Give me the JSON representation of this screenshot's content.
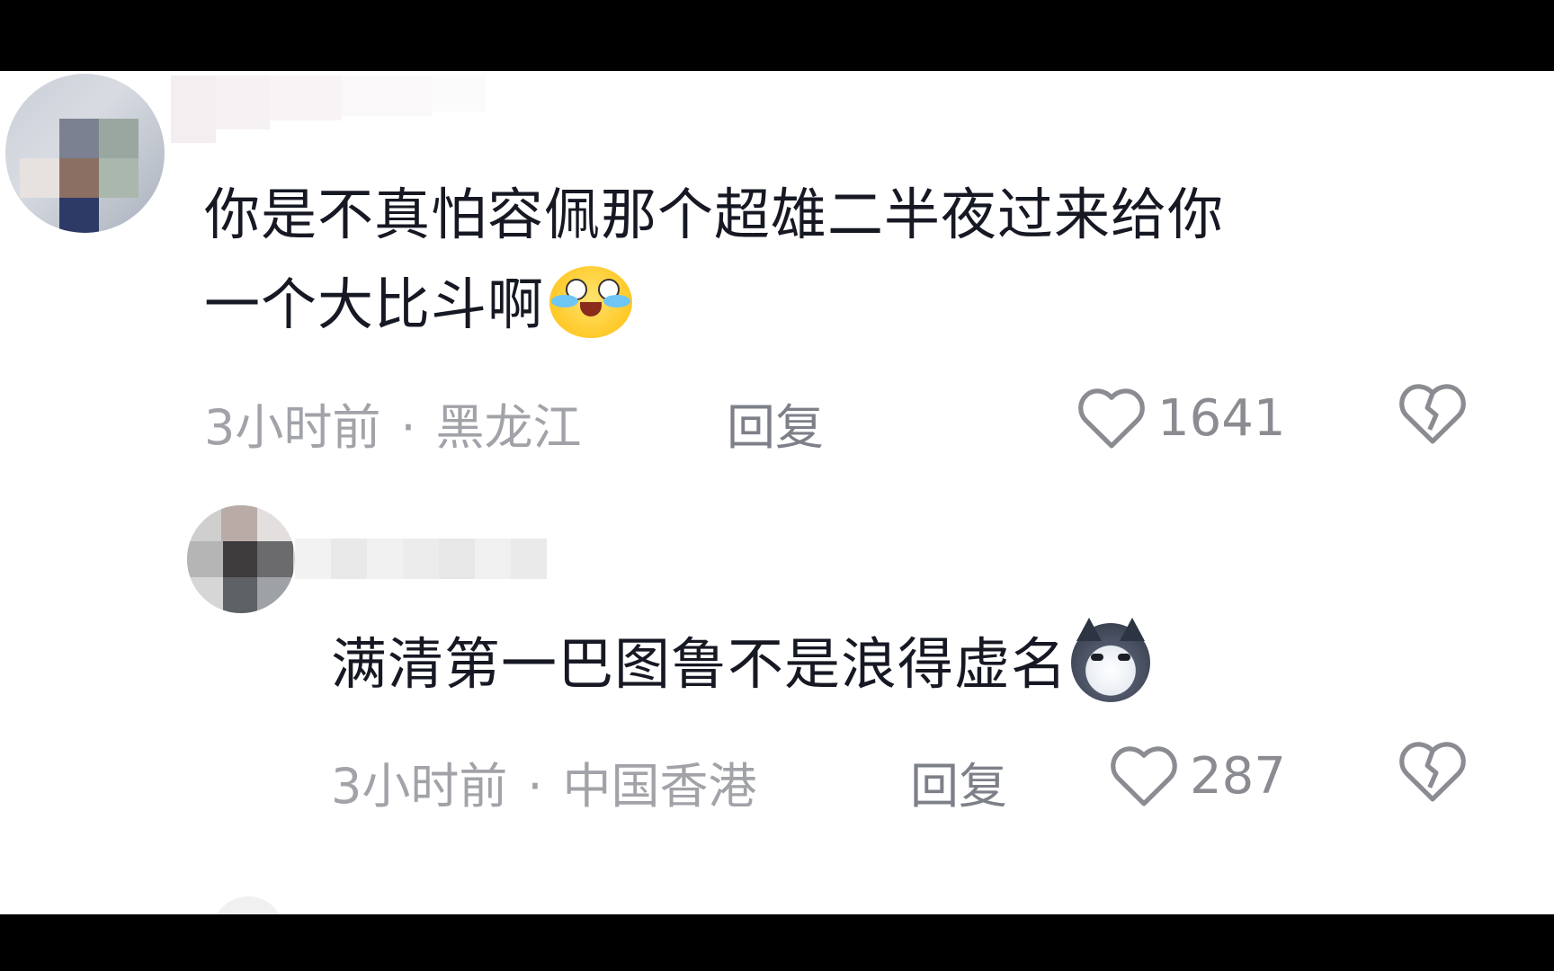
{
  "comments": [
    {
      "text_line1": "你是不真怕容佩那个超雄二半夜过来给你",
      "text_line2": "一个大比斗啊",
      "emoji": "loudly-crying-face-icon",
      "time": "3小时前",
      "location": "黑龙江",
      "reply_label": "回复",
      "likes": "1641"
    },
    {
      "text": "满清第一巴图鲁不是浪得虚名",
      "emoji": "smirking-husky-dog-icon",
      "time": "3小时前",
      "location": "中国香港",
      "reply_label": "回复",
      "likes": "287"
    }
  ],
  "separator": "·",
  "colors": {
    "text": "#161823",
    "meta": "#a1a3a8",
    "background": "#ffffff"
  }
}
